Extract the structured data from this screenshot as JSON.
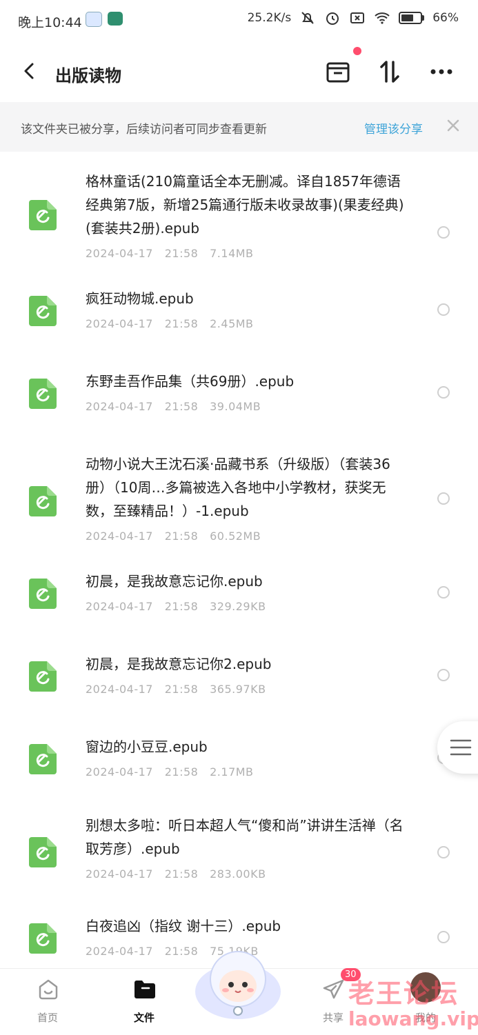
{
  "status_bar": {
    "time": "晚上10:44",
    "net_speed": "25.2K/s",
    "battery_percent": "66%",
    "battery_level": 0.66
  },
  "header": {
    "title": "出版读物"
  },
  "banner": {
    "text": "该文件夹已被分享，后续访问者可同步查看更新",
    "link": "管理该分享"
  },
  "files": [
    {
      "name": "格林童话(210篇童话全本无删减。译自1857年德语经典第7版，新增25篇通行版未收录故事)(果麦经典)(套装共2册).epub",
      "date": "2024-04-17",
      "time": "21:58",
      "size": "7.14MB"
    },
    {
      "name": "疯狂动物城.epub",
      "date": "2024-04-17",
      "time": "21:58",
      "size": "2.45MB"
    },
    {
      "name": "东野圭吾作品集（共69册）.epub",
      "date": "2024-04-17",
      "time": "21:58",
      "size": "39.04MB"
    },
    {
      "name": "动物小说大王沈石溪·品藏书系（升级版）（套装36册）（10周…多篇被选入各地中小学教材，获奖无数，至臻精品！）-1.epub",
      "date": "2024-04-17",
      "time": "21:58",
      "size": "60.52MB"
    },
    {
      "name": "初晨，是我故意忘记你.epub",
      "date": "2024-04-17",
      "time": "21:58",
      "size": "329.29KB"
    },
    {
      "name": "初晨，是我故意忘记你2.epub",
      "date": "2024-04-17",
      "time": "21:58",
      "size": "365.97KB"
    },
    {
      "name": "窗边的小豆豆.epub",
      "date": "2024-04-17",
      "time": "21:58",
      "size": "2.17MB"
    },
    {
      "name": "别想太多啦：听日本超人气“傻和尚”讲讲生活禅（名取芳彦）.epub",
      "date": "2024-04-17",
      "time": "21:58",
      "size": "283.00KB"
    },
    {
      "name": "白夜追凶（指纹 谢十三）.epub",
      "date": "2024-04-17",
      "time": "21:58",
      "size": "75.19KB"
    }
  ],
  "bottom_nav": {
    "home": "首页",
    "files": "文件",
    "share": "共享",
    "share_badge": "30",
    "mine": "我的"
  },
  "watermark": {
    "cn": "老王论坛",
    "en": "laowang.vip"
  },
  "colors": {
    "accent": "#3ea4d8",
    "file_icon": "#6ac35a",
    "badge": "#ff4d6d"
  }
}
